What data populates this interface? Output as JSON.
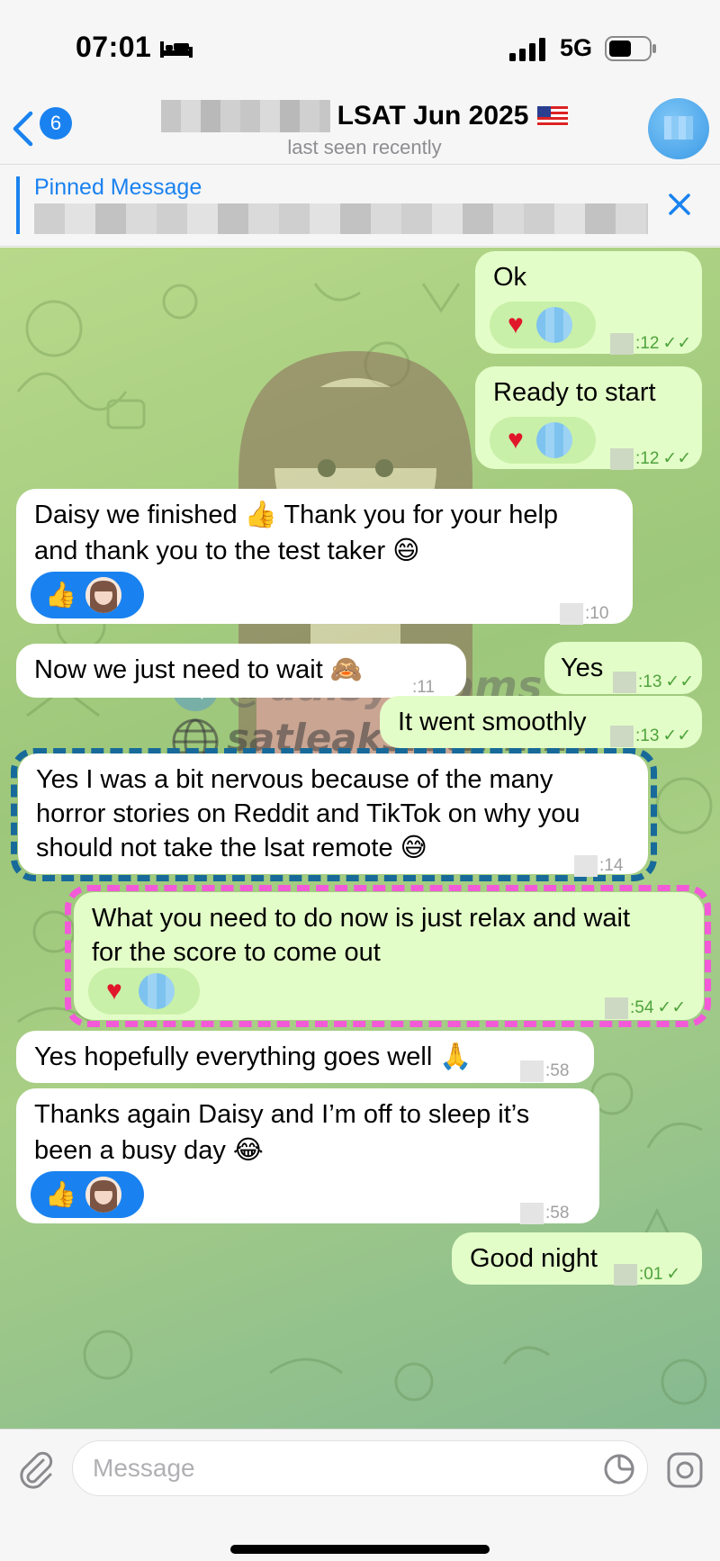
{
  "status_bar": {
    "time": "07:01",
    "network": "5G",
    "icons": [
      "bed-icon",
      "signal-icon",
      "battery-icon"
    ]
  },
  "header": {
    "back_count": "6",
    "title": "LSAT Jun 2025",
    "flag": "us-flag",
    "subtitle": "last seen recently"
  },
  "pinned": {
    "label": "Pinned Message"
  },
  "watermarks": {
    "telegram": "@daisyexams",
    "site": "satleaks.eth.limo"
  },
  "messages": [
    {
      "dir": "out",
      "text": "Ok",
      "time": ":12",
      "reactions": [
        "heart"
      ]
    },
    {
      "dir": "out",
      "text": "Ready to start",
      "time": ":12",
      "reactions": [
        "heart"
      ]
    },
    {
      "dir": "in",
      "text_l1": "Daisy we finished 👍 Thank you for your help",
      "text_l2": "and thank you to the test taker 😄",
      "time": ":10",
      "reactions": [
        "thumbs-up"
      ]
    },
    {
      "dir": "in",
      "text": "Now we just need to wait 🙈",
      "time": ":11"
    },
    {
      "dir": "out",
      "text": "Yes",
      "time": ":13"
    },
    {
      "dir": "out",
      "text": "It went smoothly",
      "time": ":13"
    },
    {
      "dir": "in",
      "text_l1": "Yes I was a bit nervous because of the many",
      "text_l2": "horror stories on Reddit and TikTok on why you",
      "text_l3": "should not take the lsat remote 😅",
      "time": ":14"
    },
    {
      "dir": "out",
      "text_l1": "What you need to do now is just relax and wait",
      "text_l2": "for the score to come out",
      "time": ":54",
      "reactions": [
        "heart"
      ]
    },
    {
      "dir": "in",
      "text": "Yes hopefully everything goes well 🙏",
      "time": ":58"
    },
    {
      "dir": "in",
      "text_l1": "Thanks again Daisy and I’m off to sleep it’s",
      "text_l2": "been a busy day 😂",
      "time": ":58",
      "reactions": [
        "thumbs-up"
      ]
    },
    {
      "dir": "out",
      "text": "Good night",
      "time": ":01"
    }
  ],
  "input": {
    "placeholder": "Message"
  },
  "colors": {
    "accent": "#1a82f0",
    "outgoing_bubble": "#e3fdc8",
    "incoming_bubble": "#ffffff",
    "highlight_blue": "#176a99",
    "highlight_pink": "#f25ad8"
  }
}
